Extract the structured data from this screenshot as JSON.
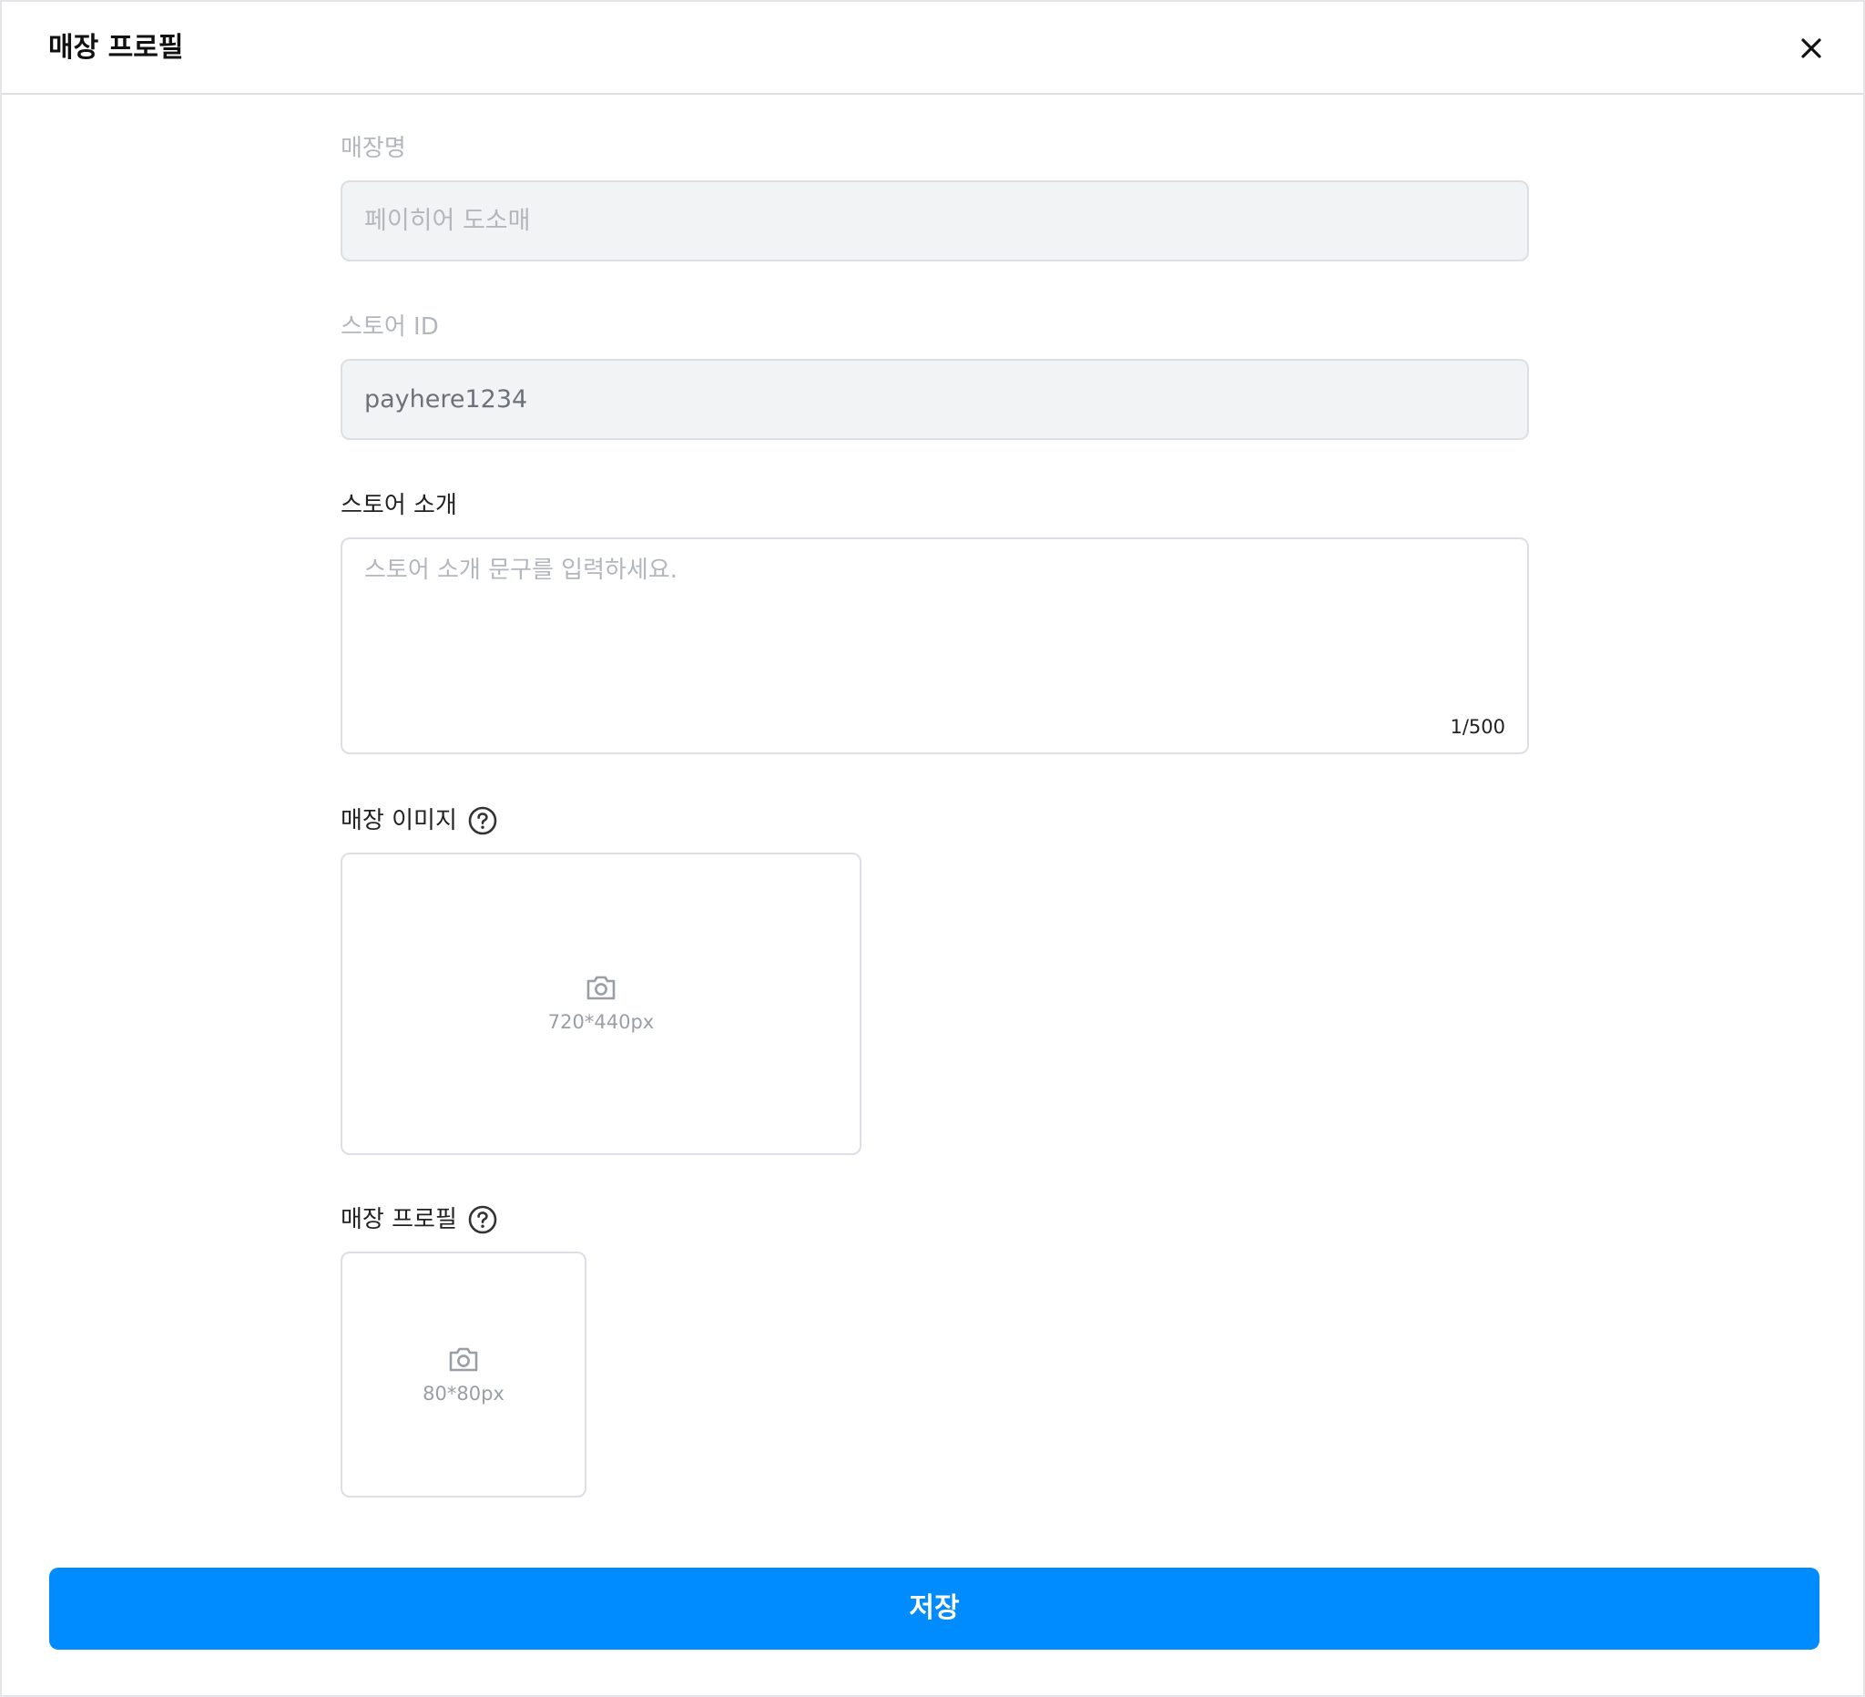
{
  "dialog": {
    "title": "매장 프로필",
    "close_icon": "close-icon"
  },
  "form": {
    "store_name": {
      "label": "매장명",
      "placeholder": "페이히어 도소매"
    },
    "store_id": {
      "label": "스토어 ID",
      "value": "payhere1234"
    },
    "store_intro": {
      "label": "스토어 소개",
      "placeholder": "스토어 소개 문구를 입력하세요.",
      "char_count": "1/500"
    },
    "store_image": {
      "label": "매장 이미지",
      "help_icon": "question-circle-icon",
      "camera_icon": "camera-icon",
      "size_hint": "720*440px"
    },
    "store_profile": {
      "label": "매장 프로필",
      "help_icon": "question-circle-icon",
      "camera_icon": "camera-icon",
      "size_hint": "80*80px"
    }
  },
  "footer": {
    "save_label": "저장"
  },
  "colors": {
    "primary": "#008bff",
    "border": "#dcdfe3",
    "disabled_bg": "#f2f3f5",
    "muted_text": "#b3b7bd"
  }
}
